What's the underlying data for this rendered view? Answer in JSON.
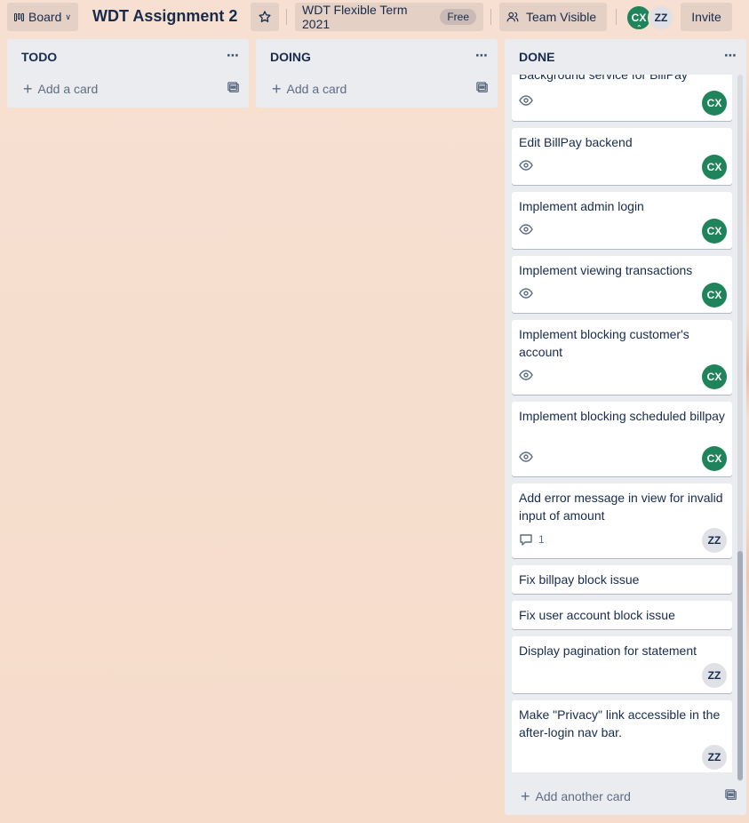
{
  "header": {
    "board_view_label": "Board",
    "board_title": "WDT Assignment 2",
    "workspace_label": "WDT Flexible Term 2021",
    "workspace_badge": "Free",
    "visibility_label": "Team Visible",
    "members": [
      {
        "initials": "CX",
        "color": "#1f845a"
      },
      {
        "initials": "ZZ",
        "color": "#dfe1e6"
      }
    ],
    "invite_label": "Invite"
  },
  "lists": {
    "todo": {
      "title": "TODO",
      "add_card_label": "Add a card"
    },
    "doing": {
      "title": "DOING",
      "add_card_label": "Add a card"
    },
    "done": {
      "title": "DONE",
      "add_card_label": "Add another card",
      "cards": [
        {
          "title": "Background service for BillPay",
          "watching": true,
          "member": "CX"
        },
        {
          "title": "Edit BillPay backend",
          "watching": true,
          "member": "CX"
        },
        {
          "title": "Implement admin login",
          "watching": true,
          "member": "CX"
        },
        {
          "title": "Implement viewing transactions",
          "watching": true,
          "member": "CX"
        },
        {
          "title": "Implement blocking customer's account",
          "watching": true,
          "member": "CX"
        },
        {
          "title": "Implement blocking scheduled billpay",
          "watching": true,
          "member": "CX"
        },
        {
          "title": "Add error message in view for invalid input of amount",
          "comments": "1",
          "member": "ZZ"
        },
        {
          "title": "Fix billpay block issue"
        },
        {
          "title": "Fix user account block issue"
        },
        {
          "title": "Display pagination for statement",
          "member": "ZZ"
        },
        {
          "title": "Make \"Privacy\" link accessible in the after-login nav bar.",
          "member": "ZZ"
        }
      ]
    }
  },
  "colors": {
    "background": "#f6dfd0",
    "list_bg": "#ebecf0",
    "avatar_cx": "#1f845a",
    "avatar_zz": "#dfe1e6"
  }
}
